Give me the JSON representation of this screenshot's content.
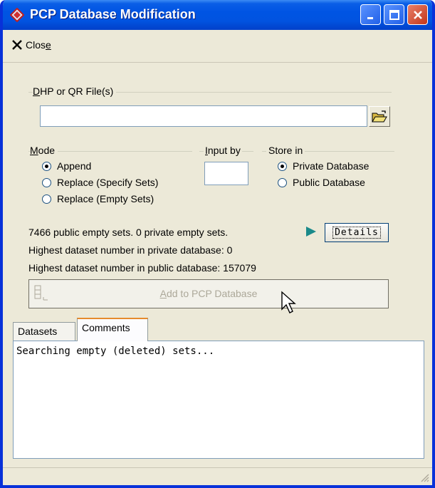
{
  "window": {
    "title": "PCP Database Modification"
  },
  "menu": {
    "close_pre": "Clos",
    "close_mnemonic": "e"
  },
  "file": {
    "label_mnemonic": "D",
    "label_rest": "HP or QR File(s)",
    "value": ""
  },
  "mode": {
    "label_mnemonic": "M",
    "label_rest": "ode",
    "options": [
      {
        "label": "Append",
        "checked": true
      },
      {
        "label": "Replace (Specify Sets)",
        "checked": false
      },
      {
        "label": "Replace (Empty Sets)",
        "checked": false
      }
    ]
  },
  "input_by": {
    "label_mnemonic": "I",
    "label_rest": "nput by",
    "value": ""
  },
  "store_in": {
    "label": "Store in",
    "options": [
      {
        "label": "Private Database",
        "checked": true
      },
      {
        "label": "Public Database",
        "checked": false
      }
    ]
  },
  "info": {
    "empty_sets": "7466 public empty sets. 0 private empty sets.",
    "private_highest": "Highest dataset number in private database: 0",
    "public_highest": "Highest dataset number in public database:  157079"
  },
  "details_button": {
    "label": "Details"
  },
  "add_button": {
    "mnemonic": "A",
    "rest": "dd to PCP Database"
  },
  "tabs": [
    {
      "label": "Datasets",
      "active": false
    },
    {
      "label": "Comments",
      "active": true
    }
  ],
  "output": {
    "text": "Searching empty (deleted) sets..."
  },
  "colors": {
    "titlebar": "#0054e3",
    "window_bg": "#ece9d8",
    "details_arrow": "#1a8a8a"
  },
  "icons": [
    "app-icon",
    "minimize-icon",
    "maximize-icon",
    "close-icon",
    "x-close-icon",
    "folder-open-icon",
    "play-arrow-icon",
    "add-icon",
    "cursor-icon",
    "size-grip-icon"
  ]
}
